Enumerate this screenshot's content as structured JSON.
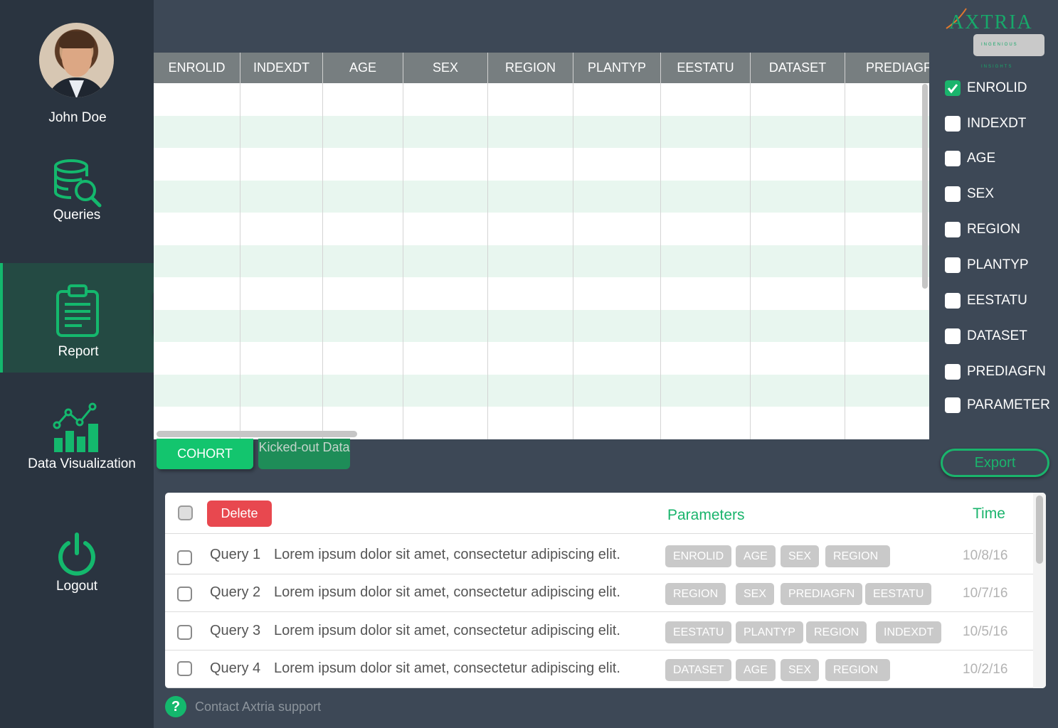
{
  "user": {
    "name": "John Doe"
  },
  "nav": {
    "queries": "Queries",
    "report": "Report",
    "data_visualization": "Data Visualization",
    "logout": "Logout"
  },
  "logo": {
    "word": "AXTRIA",
    "tagline": "INGENIOUS INSIGHTS"
  },
  "grid": {
    "columns": [
      "ENROLID",
      "INDEXDT",
      "AGE",
      "SEX",
      "REGION",
      "PLANTYP",
      "EESTATU",
      "DATASET",
      "PREDIAGF"
    ]
  },
  "column_selector": [
    {
      "label": "ENROLID",
      "checked": true
    },
    {
      "label": "INDEXDT",
      "checked": false
    },
    {
      "label": "AGE",
      "checked": false
    },
    {
      "label": "SEX",
      "checked": false
    },
    {
      "label": "REGION",
      "checked": false
    },
    {
      "label": "PLANTYP",
      "checked": false
    },
    {
      "label": "EESTATU",
      "checked": false
    },
    {
      "label": "DATASET",
      "checked": false
    },
    {
      "label": "PREDIAGFN",
      "checked": false
    },
    {
      "label": "PARAMETER",
      "checked": false
    }
  ],
  "export_label": "Export",
  "tabs": {
    "cohort": "COHORT",
    "kicked_out": "Kicked-out Data"
  },
  "queries": {
    "delete_label": "Delete",
    "params_header": "Parameters",
    "time_header": "Time",
    "rows": [
      {
        "name": "Query 1",
        "desc": "Lorem ipsum dolor sit amet, consectetur adipiscing elit.",
        "tags": [
          "ENROLID",
          "AGE",
          "SEX",
          "REGION"
        ],
        "time": "10/8/16"
      },
      {
        "name": "Query 2",
        "desc": "Lorem ipsum dolor sit amet, consectetur adipiscing elit.",
        "tags": [
          "REGION",
          "SEX",
          "PREDIAGFN",
          "EESTATU"
        ],
        "time": "10/7/16"
      },
      {
        "name": "Query 3",
        "desc": "Lorem ipsum dolor sit amet, consectetur adipiscing elit.",
        "tags": [
          "EESTATU",
          "PLANTYP",
          "REGION",
          "INDEXDT"
        ],
        "time": "10/5/16"
      },
      {
        "name": "Query 4",
        "desc": "Lorem ipsum dolor sit amet, consectetur adipiscing elit.",
        "tags": [
          "DATASET",
          "AGE",
          "SEX",
          "REGION"
        ],
        "time": "10/2/16"
      }
    ]
  },
  "support_label": "Contact Axtria support",
  "colors": {
    "accent": "#1ab46c",
    "danger": "#e8484f",
    "sidebar": "#2a3440",
    "background": "#3d4856"
  }
}
